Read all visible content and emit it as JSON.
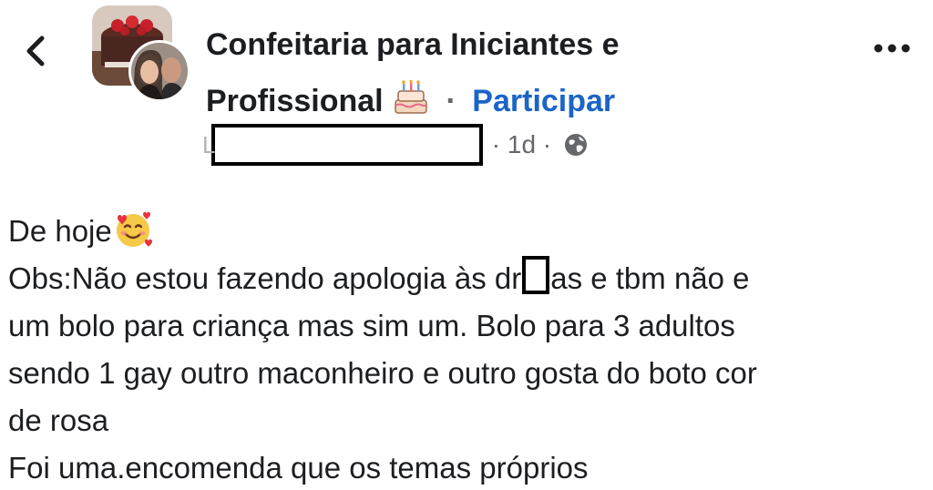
{
  "header": {
    "back_icon": "chevron-left-icon",
    "group_name_line1": "Confeitaria para Iniciantes e",
    "group_name_line2": "Profissional",
    "group_emoji": "birthday-cake-icon",
    "separator": "·",
    "join_label": "Participar",
    "more_icon": "more-options-icon"
  },
  "meta": {
    "leaked_letter": "L",
    "time": "· 1d ·",
    "privacy_icon": "globe-icon"
  },
  "post": {
    "line1_text": "De hoje",
    "line1_emoji": "smiling-face-with-hearts-icon",
    "line2_before": "Obs:Não estou fazendo apologia às dr",
    "line2_after": "as e tbm não e",
    "line3": "um bolo para criança mas sim um. Bolo para 3 adultos",
    "line4": "sendo 1 gay outro maconheiro e outro gosta do boto cor",
    "line5": "de rosa",
    "line6": "Foi uma.encomenda que os temas próprios"
  },
  "colors": {
    "text_primary": "#1c1e21",
    "text_secondary": "#65676b",
    "link_blue": "#1b64c8"
  }
}
